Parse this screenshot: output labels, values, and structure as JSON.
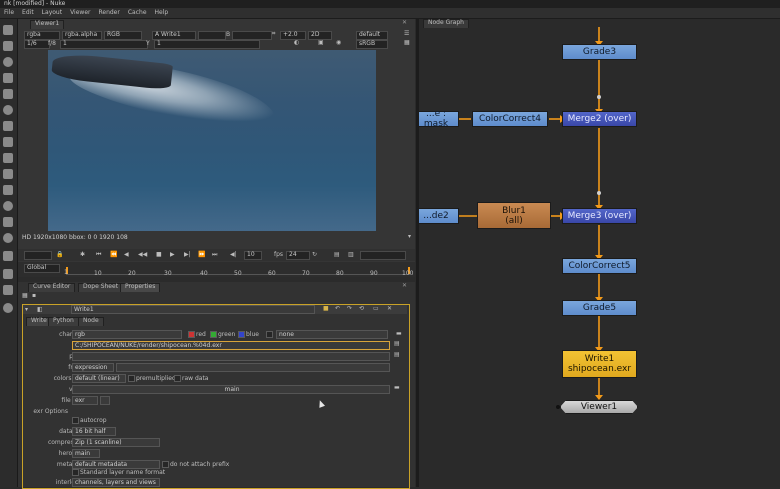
{
  "app": {
    "title": "nk [modified] - Nuke"
  },
  "menu": [
    "File",
    "Edit",
    "Layout",
    "Viewer",
    "Render",
    "Cache",
    "Help"
  ],
  "viewer": {
    "tab_label": "Viewer1",
    "row1": {
      "input_a": "rgba",
      "input_b": "rgba.alpha",
      "colorspace": "RGB",
      "a_node": "A  Write1",
      "b_label": "B",
      "zoom": "+2.0",
      "view_2d": "2D",
      "lut": "default"
    },
    "row2": {
      "frame_ratio": "1/6",
      "f_label": "f/8",
      "gain": "1",
      "y_label": "Y",
      "gamma_val": "1",
      "display": "sRGB"
    },
    "status_text": "HD 1920x1080  bbox: 0 0 1920 108",
    "timeline": {
      "frame": "10",
      "fps_label": "fps",
      "fps": "24",
      "global_label": "Global",
      "ticks": [
        "1",
        "10",
        "20",
        "30",
        "40",
        "50",
        "60",
        "70",
        "80",
        "90",
        "100"
      ]
    }
  },
  "panels": {
    "tabs": [
      "Curve Editor",
      "Dope Sheet",
      "Properties"
    ]
  },
  "properties": {
    "node_name": "Write1",
    "subtabs": [
      "Write",
      "Python",
      "Node"
    ],
    "channels_label": "channels",
    "channels_value": "rgb",
    "channel_checks": [
      "red",
      "green",
      "blue"
    ],
    "channel_none": "none",
    "file_label": "file",
    "file_path": "C:/SHIPOCEAN/NUKE/render/shipocean.%04d.exr",
    "proxy_label": "proxy",
    "frame_label": "frame",
    "frame_value": "expression",
    "colorspace_label": "colorspace",
    "colorspace_value": "default (linear)",
    "premultiplied": "premultiplied",
    "raw_data": "raw data",
    "views_label": "views",
    "views_value": "main",
    "file_type_label": "file type",
    "file_type_value": "exr",
    "exr_options": "exr Options",
    "autocrop": "autocrop",
    "datatype_label": "datatype",
    "datatype_value": "16 bit half",
    "compression_label": "compression",
    "compression_value": "Zip (1 scanline)",
    "heroview_label": "heroview",
    "heroview_value": "main",
    "metadata_label": "metadata",
    "metadata_value": "default metadata",
    "do_not_attach": "do not attach prefix",
    "standard_layer": "Standard layer name format",
    "interleave_label": "interleave",
    "interleave_value": "channels, layers and views"
  },
  "node_graph": {
    "tab_label": "Node Graph",
    "nodes": {
      "grade3": "Grade3",
      "left_mask": "...e : mask",
      "colorcorrect4": "ColorCorrect4",
      "merge2": "Merge2 (over)",
      "left_grade": "...de2",
      "blur1_line1": "Blur1",
      "blur1_line2": "(all)",
      "merge3": "Merge3 (over)",
      "colorcorrect5": "ColorCorrect5",
      "grade5": "Grade5",
      "write1_line1": "Write1",
      "write1_line2": "shipocean.exr",
      "viewer1": "Viewer1"
    },
    "colors": {
      "edge": "#f29a1a",
      "panel_bg": "#2a2a2a"
    }
  }
}
